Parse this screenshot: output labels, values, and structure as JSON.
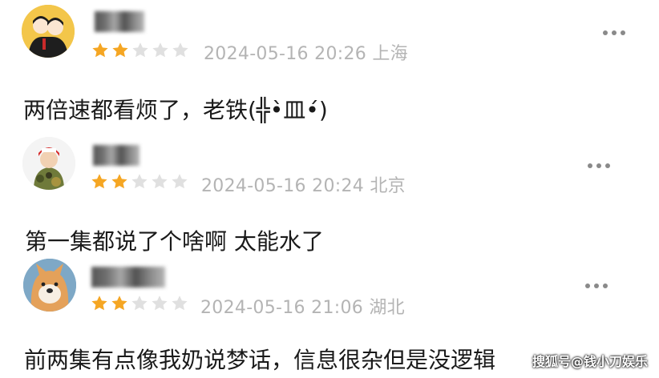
{
  "colors": {
    "star_filled": "#f5a623",
    "star_empty": "#e0e0e0",
    "meta_text": "#b4b4b4",
    "more_dots": "#8a8a8a"
  },
  "reviews": [
    {
      "avatar": "cartoon-couple-avatar",
      "rating": 2,
      "rating_max": 5,
      "date": "2024-05-16 20:26",
      "location": "上海",
      "comment": "两倍速都看烦了，老铁(╬•̀皿•́)"
    },
    {
      "avatar": "kid-in-red-cap-avatar",
      "rating": 2,
      "rating_max": 5,
      "date": "2024-05-16 20:24",
      "location": "北京",
      "comment": "第一集都说了个啥啊 太能水了"
    },
    {
      "avatar": "shiba-dog-avatar",
      "rating": 2,
      "rating_max": 5,
      "date": "2024-05-16 21:06",
      "location": "湖北",
      "comment": "前两集有点像我奶说梦话，信息很杂但是没逻辑"
    }
  ],
  "watermark": "搜狐号@钱小刀娱乐"
}
